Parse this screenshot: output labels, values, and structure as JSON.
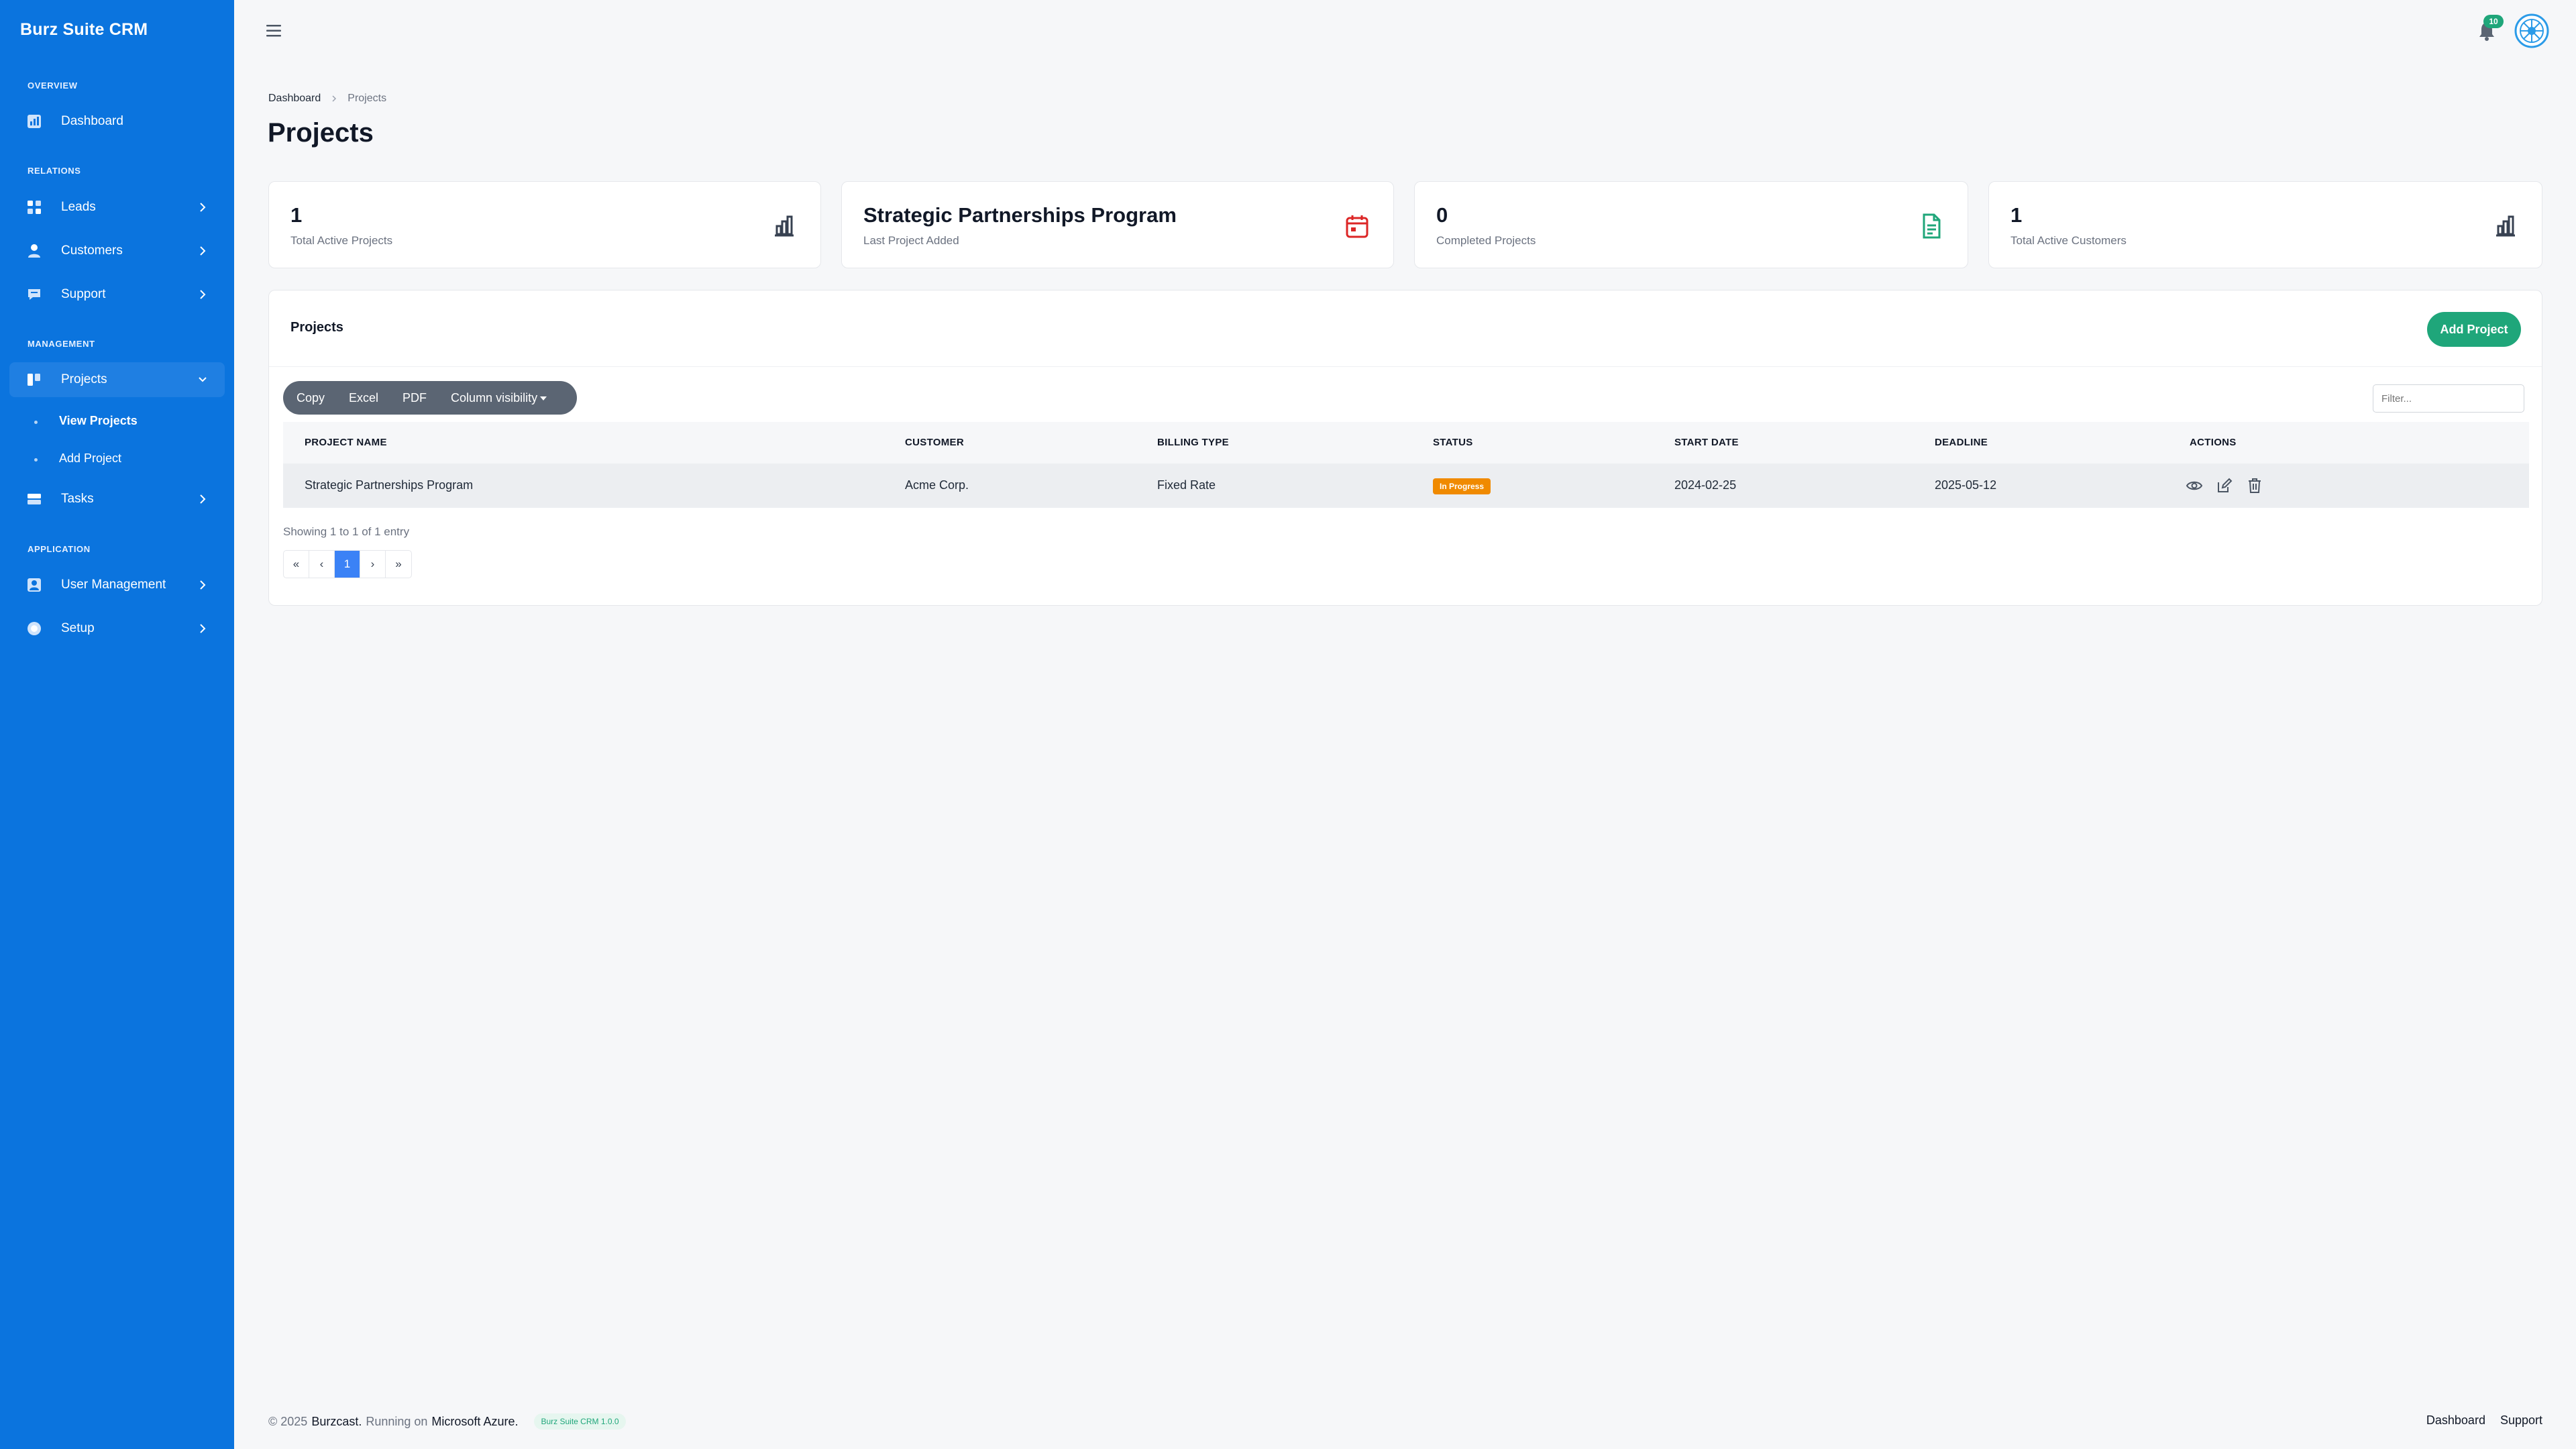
{
  "brand": "Burz Suite CRM",
  "sidebar": {
    "sections": [
      "OVERVIEW",
      "RELATIONS",
      "MANAGEMENT",
      "APPLICATION"
    ],
    "items": [
      {
        "label": "Dashboard",
        "icon": "dashboard-icon"
      },
      {
        "label": "Leads",
        "icon": "grid-icon"
      },
      {
        "label": "Customers",
        "icon": "user-icon"
      },
      {
        "label": "Support",
        "icon": "chat-icon"
      },
      {
        "label": "Projects",
        "icon": "kanban-icon",
        "expanded": true
      },
      {
        "label": "Tasks",
        "icon": "tasks-icon"
      },
      {
        "label": "User Management",
        "icon": "user-badge-icon"
      },
      {
        "label": "Setup",
        "icon": "settings-icon"
      }
    ],
    "subitems": [
      {
        "label": "View Projects",
        "active": true
      },
      {
        "label": "Add Project",
        "active": false
      }
    ]
  },
  "topbar": {
    "notification_count": "10"
  },
  "breadcrumb": [
    "Dashboard",
    "Projects"
  ],
  "page_title": "Projects",
  "stats": [
    {
      "value": "1",
      "label": "Total Active Projects",
      "icon": "bar-chart-icon",
      "color": "#374151"
    },
    {
      "value": "Strategic Partnerships Program",
      "label": "Last Project Added",
      "icon": "calendar-icon",
      "color": "#dc2626"
    },
    {
      "value": "0",
      "label": "Completed Projects",
      "icon": "document-icon",
      "color": "#1fa67a"
    },
    {
      "value": "1",
      "label": "Total Active Customers",
      "icon": "bar-chart-icon",
      "color": "#374151"
    }
  ],
  "panel": {
    "title": "Projects",
    "add_label": "Add Project",
    "buttons": [
      "Copy",
      "Excel",
      "PDF",
      "Column visibility"
    ],
    "filter_placeholder": "Filter..."
  },
  "table": {
    "columns": [
      "PROJECT NAME",
      "CUSTOMER",
      "BILLING TYPE",
      "STATUS",
      "START DATE",
      "DEADLINE",
      "ACTIONS"
    ],
    "rows": [
      {
        "name": "Strategic Partnerships Program",
        "customer": "Acme Corp.",
        "billing": "Fixed Rate",
        "status": "In Progress",
        "start": "2024-02-25",
        "deadline": "2025-05-12"
      }
    ],
    "showing": "Showing 1 to 1 of 1 entry",
    "pager": [
      "«",
      "‹",
      "1",
      "›",
      "»"
    ]
  },
  "footer": {
    "copyright": "© 2025",
    "company": "Burzcast.",
    "running": "Running on",
    "platform": "Microsoft Azure.",
    "version": "Burz Suite CRM 1.0.0",
    "links": [
      "Dashboard",
      "Support"
    ]
  },
  "colors": {
    "sidebar": "#0b74de",
    "accent_green": "#1fa67a",
    "status_orange": "#f08a00",
    "pager_active": "#3b82f6"
  }
}
